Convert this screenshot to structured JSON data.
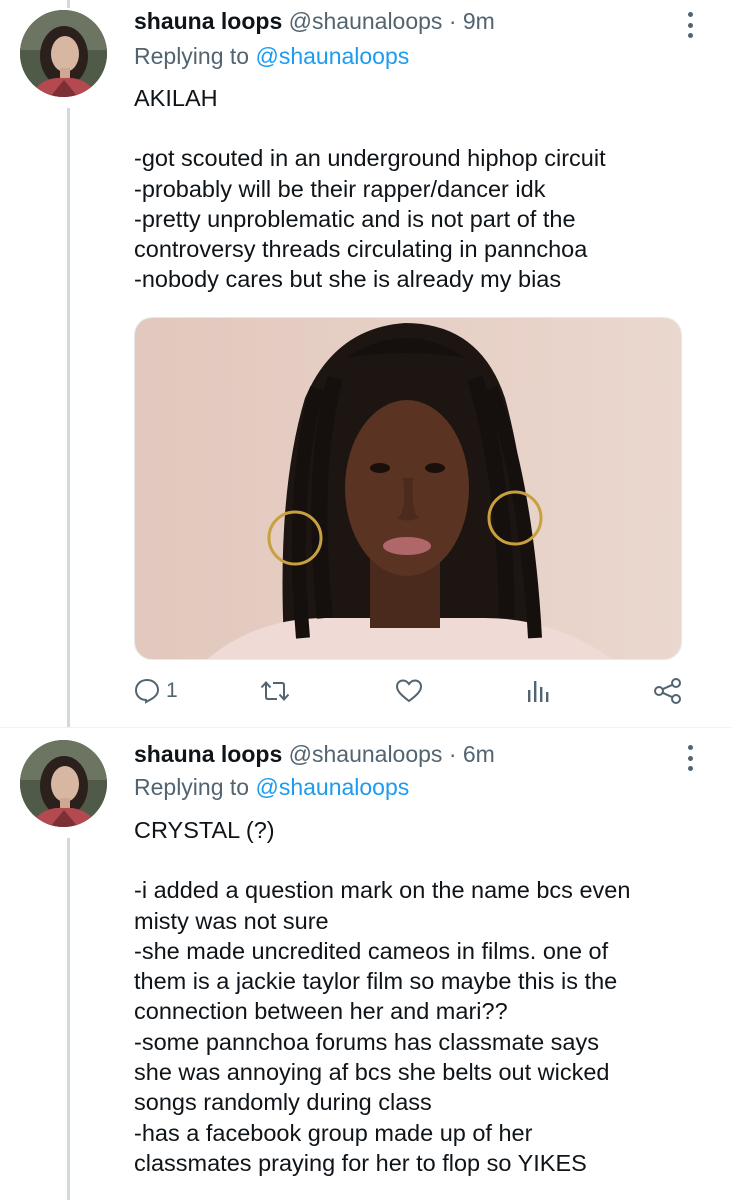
{
  "tweets": [
    {
      "display_name": "shauna loops",
      "handle": "@shaunaloops",
      "separator": "·",
      "time": "9m",
      "replying_prefix": "Replying to",
      "replying_handle": "@shaunaloops",
      "lines": [
        "AKILAH",
        "",
        "-got scouted in an underground hiphop circuit",
        "-probably will be their rapper/dancer idk",
        "-pretty unproblematic and is not part of the",
        "controversy threads circulating in pannchoa",
        "-nobody cares but she is already my bias"
      ],
      "media": "photo",
      "actions": {
        "reply_count": "1"
      },
      "icons": [
        "reply-icon",
        "retweet-icon",
        "like-icon",
        "views-icon",
        "share-icon"
      ]
    },
    {
      "display_name": "shauna loops",
      "handle": "@shaunaloops",
      "separator": "·",
      "time": "6m",
      "replying_prefix": "Replying to",
      "replying_handle": "@shaunaloops",
      "lines": [
        "CRYSTAL (?)",
        "",
        "-i added a question mark on the name bcs even",
        "misty was not sure",
        "-she made uncredited cameos in films. one of",
        "them is a jackie taylor film so maybe this is the",
        "connection between her and mari??",
        "-some pannchoa forums has classmate says",
        "she was annoying af bcs she belts out wicked",
        "songs randomly during class",
        "-has a facebook group made up of her",
        "classmates praying for her to flop so YIKES"
      ]
    }
  ],
  "colors": {
    "accent": "#1d9bf0",
    "muted": "#536471",
    "text": "#0f1419",
    "thread_line": "#cfd9de"
  }
}
